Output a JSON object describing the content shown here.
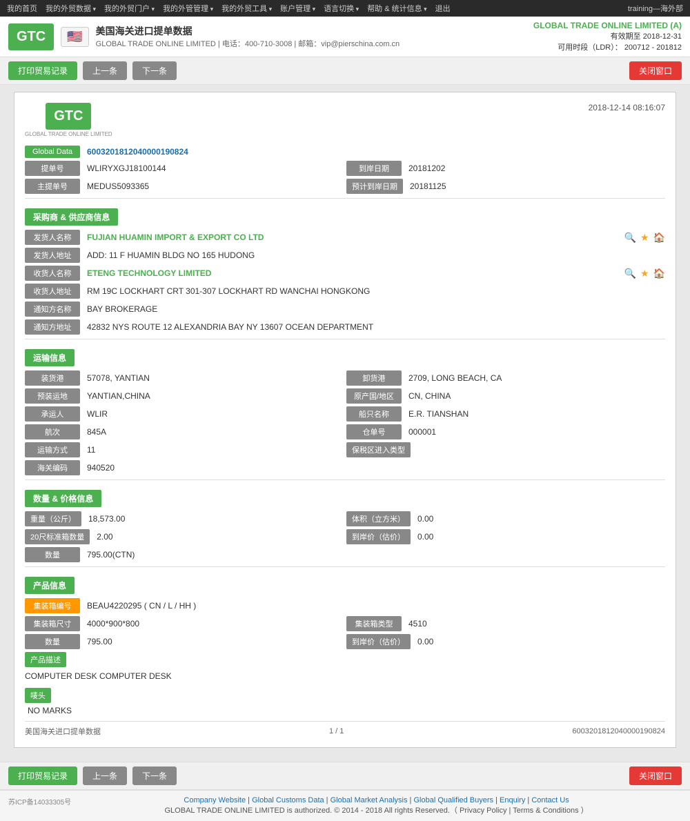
{
  "topNav": {
    "items": [
      {
        "label": "我的首页",
        "id": "home"
      },
      {
        "label": "我的外贸数据",
        "id": "trade-data",
        "hasDropdown": true
      },
      {
        "label": "我的外贸门户",
        "id": "portal",
        "hasDropdown": true
      },
      {
        "label": "我的外管管理",
        "id": "management",
        "hasDropdown": true
      },
      {
        "label": "我的外贸工具",
        "id": "tools",
        "hasDropdown": true
      },
      {
        "label": "账户管理",
        "id": "account",
        "hasDropdown": true
      },
      {
        "label": "语言切换",
        "id": "language",
        "hasDropdown": true
      },
      {
        "label": "帮助 & 统计信息",
        "id": "help",
        "hasDropdown": true
      },
      {
        "label": "退出",
        "id": "logout"
      }
    ],
    "userInfo": "training—海外部"
  },
  "header": {
    "logoText": "GTC",
    "logoSubtitle": "GLOBAL TRADE ONLINE LIMITED",
    "flagEmoji": "🇺🇸",
    "title": "美国海关进口提单数据",
    "subtitle": "GLOBAL TRADE ONLINE LIMITED | 电话：400-710-3008 | 邮箱：vip@pierschina.com.cn",
    "companyName": "GLOBAL TRADE ONLINE LIMITED (A)",
    "expireLabel": "有效期至",
    "expireDate": "2018-12-31",
    "ldrLabel": "可用时段（LDR）：",
    "ldrValue": "200712 - 201812"
  },
  "toolbar": {
    "printBtn": "打印贸易记录",
    "prevBtn": "上一条",
    "nextBtn": "下一条",
    "closeBtn": "关闭窗口"
  },
  "document": {
    "timestamp": "2018-12-14 08:16:07",
    "globalData": {
      "label": "Global Data",
      "value": "6003201812040000190824"
    },
    "billNo": {
      "label": "提单号",
      "value": "WLIRYXGJ18100144"
    },
    "arrivalDate": {
      "label": "到岸日期",
      "value": "20181202"
    },
    "masterBill": {
      "label": "主提单号",
      "value": "MEDUS5093365"
    },
    "estimatedDate": {
      "label": "预计到岸日期",
      "value": "20181125"
    },
    "buyerSupplier": {
      "sectionTitle": "采购商 & 供应商信息",
      "shipperLabel": "发货人名称",
      "shipperValue": "FUJIAN HUAMIN IMPORT & EXPORT CO LTD",
      "shipperAddrLabel": "发货人地址",
      "shipperAddrValue": "ADD: 11 F HUAMIN BLDG NO 165 HUDONG",
      "consigneeLabel": "收货人名称",
      "consigneeValue": "ETENG TECHNOLOGY LIMITED",
      "consigneeAddrLabel": "收货人地址",
      "consigneeAddrValue": "RM 19C LOCKHART CRT 301-307 LOCKHART RD WANCHAI HONGKONG",
      "notifyLabel": "通知方名称",
      "notifyValue": "BAY BROKERAGE",
      "notifyAddrLabel": "通知方地址",
      "notifyAddrValue": "42832 NYS ROUTE 12 ALEXANDRIA BAY NY 13607 OCEAN DEPARTMENT"
    },
    "transport": {
      "sectionTitle": "运输信息",
      "loadPortLabel": "装货港",
      "loadPortValue": "57078, YANTIAN",
      "dischargePortLabel": "卸货港",
      "dischargePortValue": "2709, LONG BEACH, CA",
      "loadPlaceLabel": "预装运地",
      "loadPlaceValue": "YANTIAN,CHINA",
      "originLabel": "原产国/地区",
      "originValue": "CN, CHINA",
      "carrierLabel": "承运人",
      "carrierValue": "WLIR",
      "vesselLabel": "船只名称",
      "vesselValue": "E.R. TIANSHAN",
      "voyageLabel": "航次",
      "voyageValue": "845A",
      "containerNoLabel": "仓单号",
      "containerNoValue": "000001",
      "transportModeLabel": "运输方式",
      "transportModeValue": "11",
      "ftzLabel": "保税区进入类型",
      "ftzValue": "",
      "customsCodeLabel": "海关编码",
      "customsCodeValue": "940520"
    },
    "quantityPrice": {
      "sectionTitle": "数量 & 价格信息",
      "weightLabel": "重量（公斤）",
      "weightValue": "18,573.00",
      "volumeLabel": "体积（立方米）",
      "volumeValue": "0.00",
      "container20Label": "20尺标准箱数量",
      "container20Value": "2.00",
      "arrivalPriceLabel": "到岸价（估价）",
      "arrivalPriceValue": "0.00",
      "quantityLabel": "数量",
      "quantityValue": "795.00(CTN)"
    },
    "productInfo": {
      "sectionTitle": "产品信息",
      "containerNoLabel": "集装箱编号",
      "containerNoValue": "BEAU4220295 ( CN / L / HH )",
      "containerSizeLabel": "集装箱尺寸",
      "containerSizeValue": "4000*900*800",
      "containerTypeLabel": "集装箱类型",
      "containerTypeValue": "4510",
      "quantityLabel": "数量",
      "quantityValue": "795.00",
      "arrivalPriceLabel": "到岸价（估价）",
      "arrivalPriceValue": "0.00",
      "descLabel": "产品描述",
      "descValue": "COMPUTER DESK COMPUTER DESK",
      "marksLabel": "唛头",
      "marksValue": "NO MARKS"
    },
    "footer": {
      "source": "美国海关进口提单数据",
      "pageInfo": "1 / 1",
      "recordNo": "6003201812040000190824"
    }
  },
  "pageFooter": {
    "icp": "苏ICP备14033305号",
    "links": [
      "Company Website",
      "Global Customs Data",
      "Global Market Analysis",
      "Global Qualified Buyers",
      "Enquiry",
      "Contact Us"
    ],
    "copyright": "GLOBAL TRADE ONLINE LIMITED is authorized. © 2014 - 2018 All rights Reserved.（ Privacy Policy | Terms & Conditions ）"
  }
}
